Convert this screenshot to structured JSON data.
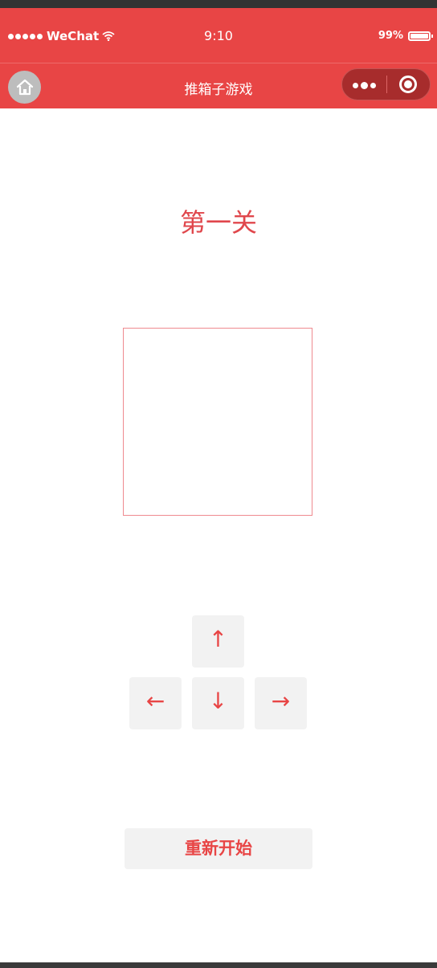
{
  "status_bar": {
    "carrier": "WeChat",
    "time": "9:10",
    "battery_percent": "99%",
    "signal_icon": "signal-dots-icon",
    "wifi_icon": "wifi-icon",
    "battery_icon": "battery-icon"
  },
  "nav_bar": {
    "title": "推箱子游戏",
    "home_icon": "home-icon",
    "more_icon": "more-dots-icon",
    "close_icon": "target-close-icon"
  },
  "game": {
    "level_title": "第一关",
    "controls": {
      "up": "↑",
      "down": "↓",
      "left": "←",
      "right": "→"
    },
    "restart_label": "重新开始"
  },
  "colors": {
    "theme": "#e84545",
    "button_bg": "#f2f2f2",
    "board_border": "#ef8a8f"
  }
}
